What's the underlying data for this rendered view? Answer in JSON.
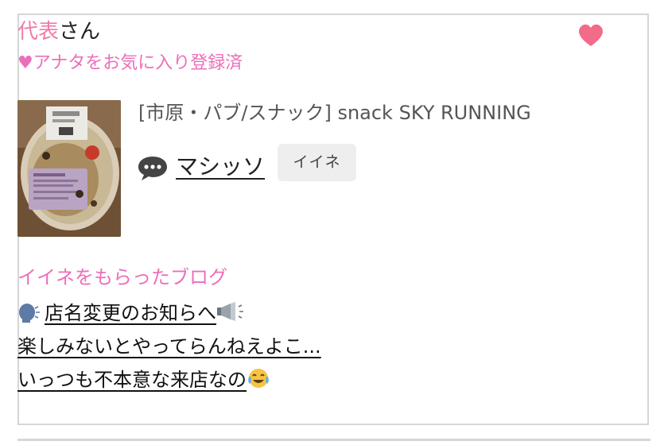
{
  "header": {
    "role": "代表",
    "suffix": "さん",
    "favorite_status": "♥アナタをお気に入り登録済"
  },
  "shop": {
    "info": "[市原・パブ/スナック]  snack SKY RUNNING"
  },
  "user": {
    "name": "マシッソ",
    "like_badge": "イイネ"
  },
  "blogs": {
    "section_title": "イイネをもらったブログ",
    "posts": [
      "店名変更のお知らへ",
      "楽しみないとやってらんねえよこ...",
      "いっつも不本意な来店なの"
    ]
  },
  "icons": {
    "favorite": "heart-icon",
    "comment": "speech-bubble-icon",
    "speaking_head": "speaking-head-emoji",
    "megaphone": "megaphone-emoji",
    "tears_of_joy": "tears-of-joy-emoji"
  },
  "colors": {
    "pink_text": "#ec6fba",
    "role_pink": "#f07aa8",
    "heart": "#f26b8a",
    "badge_bg": "#eeeeee",
    "border": "#d6d6d6"
  }
}
